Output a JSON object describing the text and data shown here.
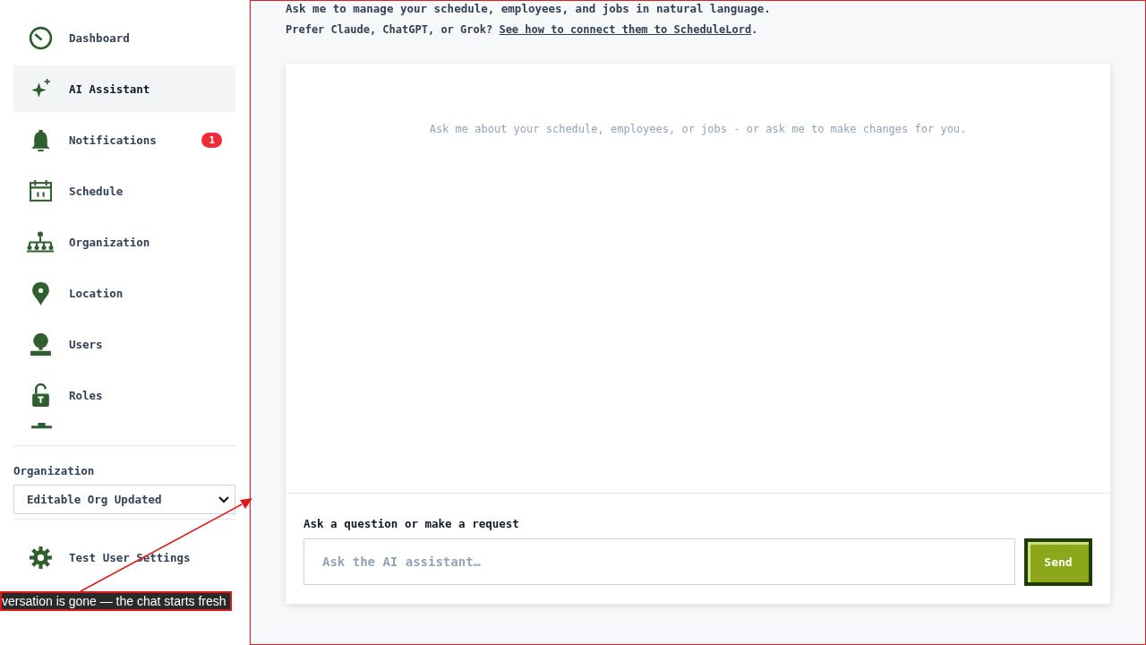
{
  "sidebar": {
    "items": [
      {
        "label": "Dashboard",
        "selected": false
      },
      {
        "label": "AI Assistant",
        "selected": true
      },
      {
        "label": "Notifications",
        "selected": false,
        "badge": "1"
      },
      {
        "label": "Schedule",
        "selected": false
      },
      {
        "label": "Organization",
        "selected": false
      },
      {
        "label": "Location",
        "selected": false
      },
      {
        "label": "Users",
        "selected": false
      },
      {
        "label": "Roles",
        "selected": false
      }
    ],
    "org_label": "Organization",
    "org_value": "Editable Org Updated",
    "footer_items": [
      {
        "label": "Test User Settings"
      }
    ]
  },
  "main": {
    "intro": "Ask me to manage your schedule, employees, and jobs in natural language.",
    "connect_prefix": "Prefer Claude, ChatGPT, or Grok? ",
    "connect_link": "See how to connect them to ScheduleLord",
    "connect_suffix": "."
  },
  "chat": {
    "empty_hint": "Ask me about your schedule, employees, or jobs - or ask me to make changes for you.",
    "input_label": "Ask a question or make a request",
    "placeholder": "Ask the AI assistant…",
    "send": "Send"
  },
  "annotation": {
    "text": "versation is gone — the chat starts fresh"
  }
}
